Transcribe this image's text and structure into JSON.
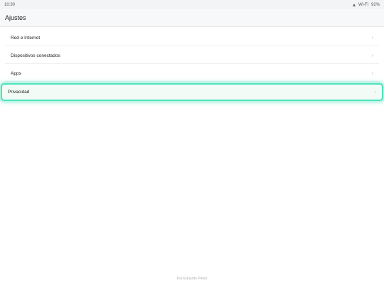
{
  "status_bar": {
    "time": "10:30",
    "wifi": "Wi-Fi",
    "battery": "92%"
  },
  "header": {
    "title": "Ajustes"
  },
  "settings": {
    "items": [
      {
        "label": "Red e Internet",
        "chevron": "›"
      },
      {
        "label": "Dispositivos conectados",
        "chevron": "›"
      },
      {
        "label": "Apps",
        "chevron": "›"
      },
      {
        "label": "Privacidad",
        "chevron": "›"
      }
    ]
  },
  "footer": {
    "credit": "Por Eduardo Pérez"
  },
  "colors": {
    "highlight": "#4ee3bd",
    "background": "#ffffff"
  }
}
